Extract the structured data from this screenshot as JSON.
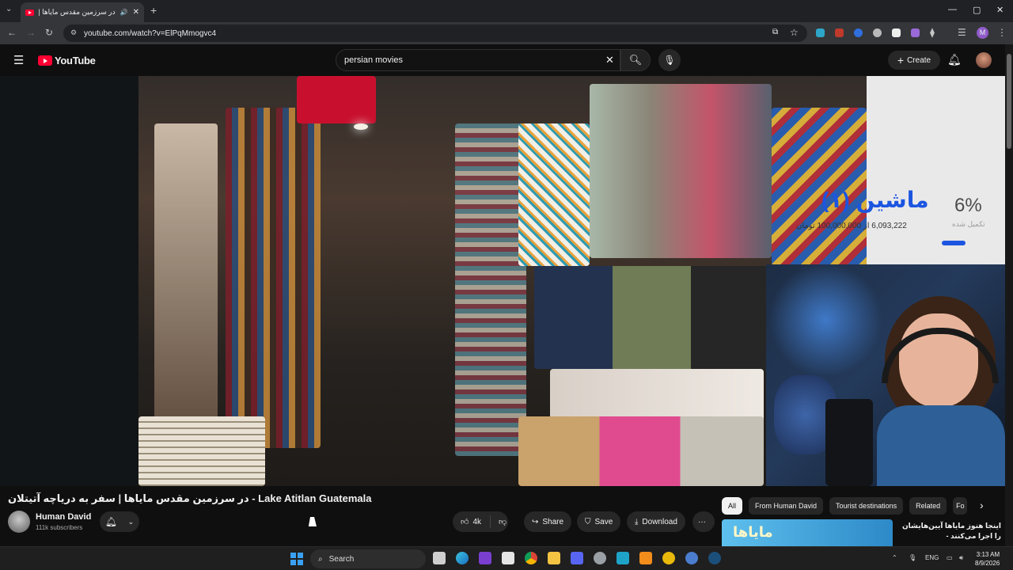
{
  "browser": {
    "tab_title": "در سرزمین مقدس مایاها | سف...",
    "new_tab": "+",
    "url": "youtube.com/watch?v=ElPqMmogvc4",
    "profile_initial": "M",
    "window_controls": [
      "minimize",
      "restore",
      "close"
    ]
  },
  "youtube": {
    "logo_text": "YouTube",
    "search_value": "persian movies",
    "create_label": "Create"
  },
  "video": {
    "overlay_brand": "ماشین (۱)",
    "overlay_amount": "6,093,222 از 100,000,000 تومان",
    "overlay_percent": "6%",
    "overlay_percent_sub": "تکمیل شده",
    "title": "در سرزمین مقدس مایاها | سفر به دریاچه آتیتلان - Lake Atitlan Guatemala",
    "channel_name": "Human David",
    "subscribers": "111k subscribers",
    "likes": "4k",
    "share_label": "Share",
    "save_label": "Save",
    "download_label": "Download"
  },
  "chips": [
    "All",
    "From Human David",
    "Tourist destinations",
    "Related",
    "Fo"
  ],
  "recommendation": {
    "title": "اینجا هنوز مایاها آیین‌هایشان را اجرا می‌کنند -",
    "thumb_text": "مایاها"
  },
  "taskbar": {
    "search_label": "Search",
    "language": "ENG",
    "time": "3:13 AM",
    "date": "8/9/2026"
  },
  "icons": {
    "accent": "#ff0033",
    "brand_blue": "#1c55e0"
  }
}
